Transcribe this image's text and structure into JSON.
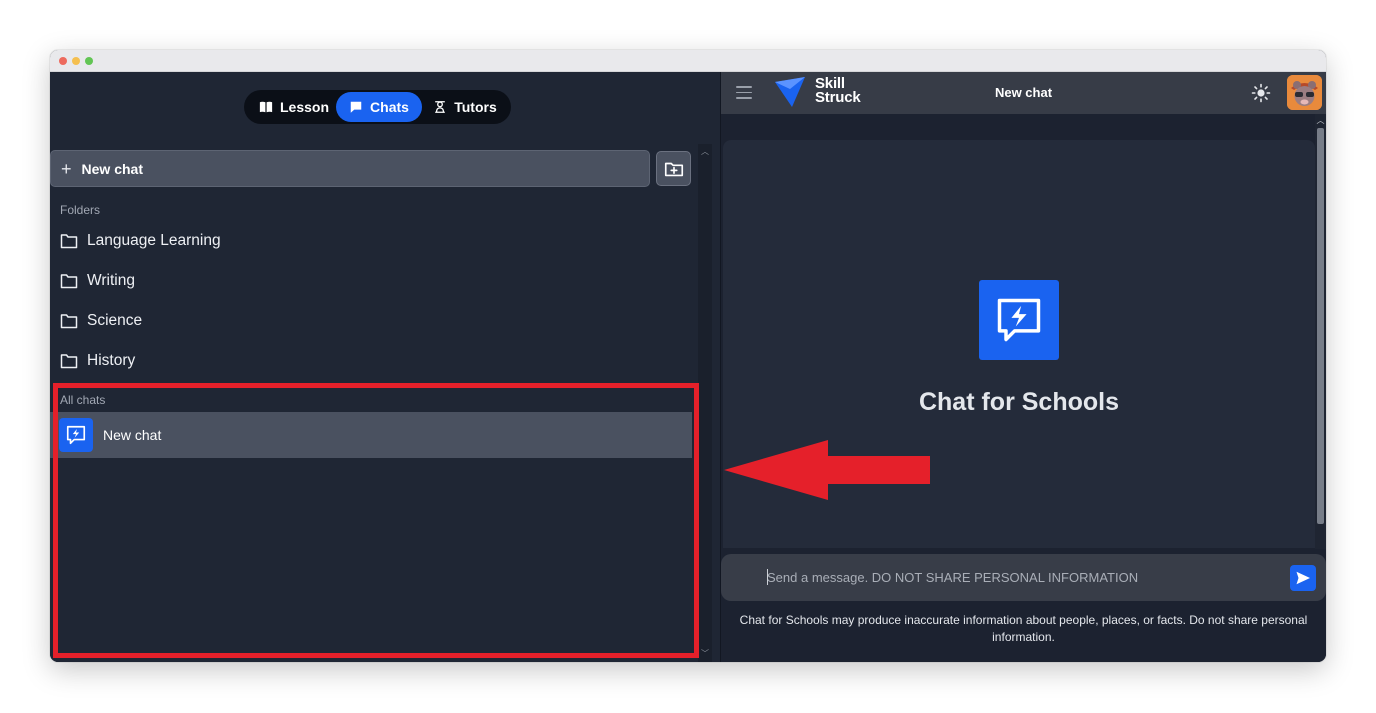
{
  "tabs": [
    {
      "label": "Lesson",
      "icon": "book-icon",
      "active": false
    },
    {
      "label": "Chats",
      "icon": "chat-icon",
      "active": true
    },
    {
      "label": "Tutors",
      "icon": "tutors-icon",
      "active": false
    }
  ],
  "sidebar": {
    "new_chat_label": "New chat",
    "folders_label": "Folders",
    "folders": [
      "Language Learning",
      "Writing",
      "Science",
      "History"
    ],
    "all_chats_label": "All chats",
    "chats": [
      "New chat"
    ]
  },
  "header": {
    "logo_line1": "Skill",
    "logo_line2": "Struck",
    "title": "New chat"
  },
  "main": {
    "title": "Chat for Schools",
    "input_placeholder": "Send a message. DO NOT SHARE PERSONAL INFORMATION",
    "disclaimer": "Chat for Schools may produce inaccurate information about people, places, or facts. Do not share personal information."
  },
  "colors": {
    "accent": "#1a63f0",
    "sidebar_bg": "#1f2634",
    "highlight": "#e5202a"
  }
}
